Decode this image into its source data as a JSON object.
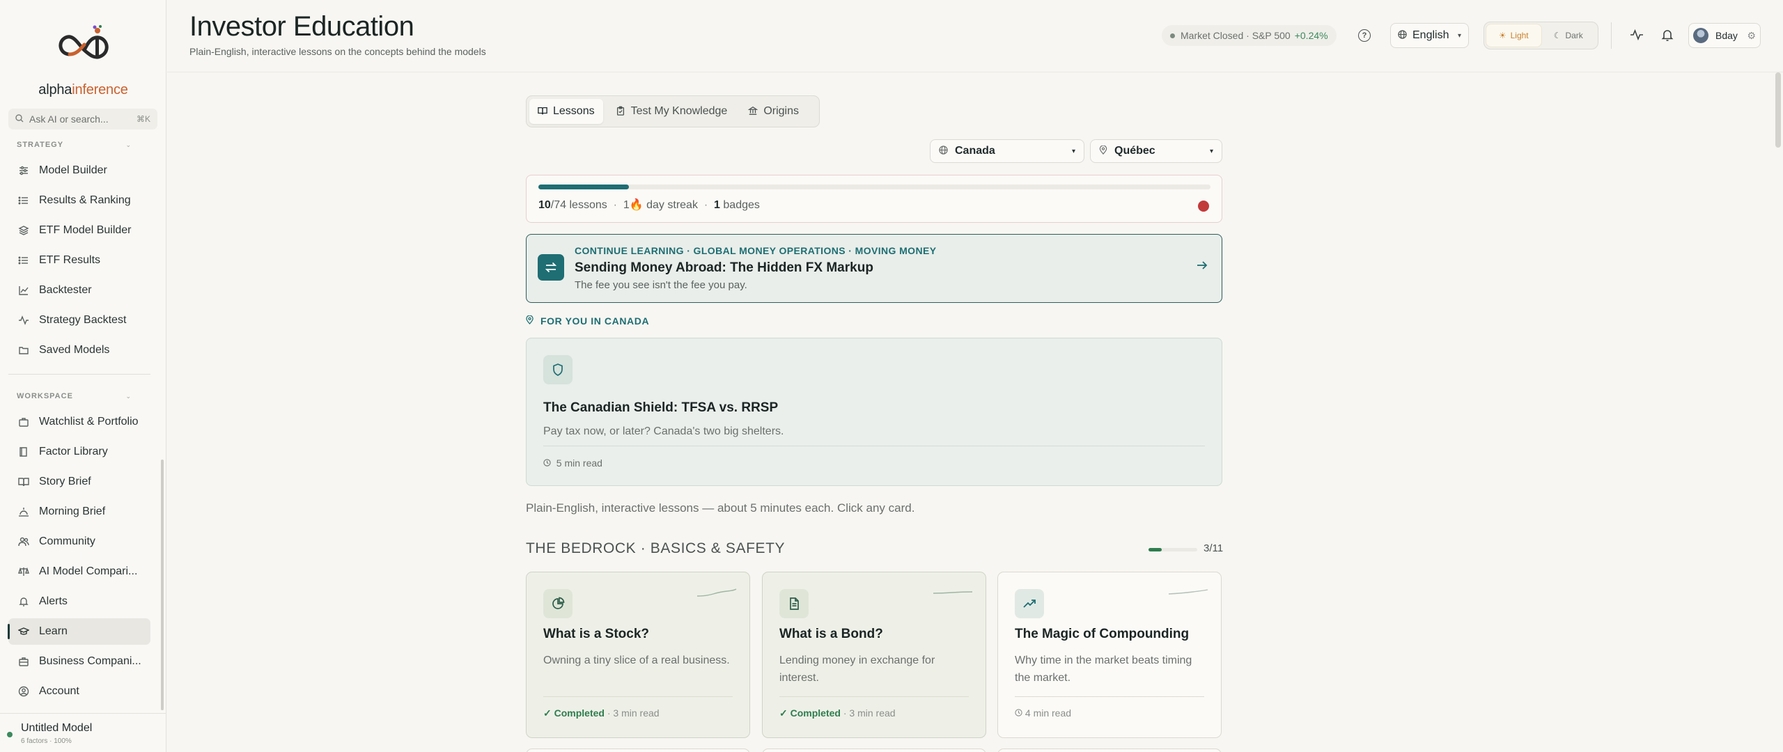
{
  "sidebar": {
    "brand_prefix": "alpha",
    "brand_suffix": "inference",
    "search_placeholder": "Ask AI or search...",
    "search_shortcut": "⌘K",
    "strategy_label": "STRATEGY",
    "strategy_items": [
      {
        "label": "Model Builder",
        "icon": "sliders-icon"
      },
      {
        "label": "Results & Ranking",
        "icon": "list-icon"
      },
      {
        "label": "ETF Model Builder",
        "icon": "layers-icon"
      },
      {
        "label": "ETF Results",
        "icon": "list-icon"
      },
      {
        "label": "Backtester",
        "icon": "chart-line-icon"
      },
      {
        "label": "Strategy Backtest",
        "icon": "activity-icon"
      },
      {
        "label": "Saved Models",
        "icon": "folder-icon"
      }
    ],
    "workspace_label": "WORKSPACE",
    "workspace_items": [
      {
        "label": "Watchlist & Portfolio",
        "icon": "briefcase-icon"
      },
      {
        "label": "Factor Library",
        "icon": "book-icon"
      },
      {
        "label": "Story Brief",
        "icon": "book-open-icon"
      },
      {
        "label": "Morning Brief",
        "icon": "sunrise-icon"
      },
      {
        "label": "Community",
        "icon": "users-icon"
      },
      {
        "label": "AI Model Compari...",
        "icon": "scale-icon"
      },
      {
        "label": "Alerts",
        "icon": "bell-icon"
      },
      {
        "label": "Learn",
        "icon": "graduation-cap-icon",
        "active": true
      },
      {
        "label": "Business Compani...",
        "icon": "building-icon"
      },
      {
        "label": "Account",
        "icon": "user-circle-icon"
      }
    ],
    "model": {
      "name": "Untitled Model",
      "meta": "6 factors · 100%"
    }
  },
  "header": {
    "title": "Investor Education",
    "subtitle": "Plain-English, interactive lessons on the concepts behind the models",
    "market_status": "Market Closed · S&P 500",
    "market_change": "+0.24%",
    "help": "?",
    "language": "English",
    "theme_light": "Light",
    "theme_dark": "Dark",
    "user_name": "Bday"
  },
  "main": {
    "tabs": [
      {
        "label": "Lessons",
        "icon": "book-icon",
        "selected": true
      },
      {
        "label": "Test My Knowledge",
        "icon": "clipboard-icon"
      },
      {
        "label": "Origins",
        "icon": "landmark-icon"
      }
    ],
    "country": "Canada",
    "region": "Québec",
    "progress": {
      "completed": "10",
      "total": "/74 lessons",
      "sep1": "·",
      "streak": "1",
      "streak_emoji": "🔥",
      "streak_label": "day streak",
      "sep2": "·",
      "badges": "1",
      "badges_label": "badges",
      "fraction": 0.135
    },
    "continue": {
      "kicker": "CONTINUE LEARNING · GLOBAL MONEY OPERATIONS · MOVING MONEY",
      "title": "Sending Money Abroad: The Hidden FX Markup",
      "subtitle": "The fee you see isn't the fee you pay."
    },
    "for_you_label": "FOR YOU IN CANADA",
    "featured": {
      "title": "The Canadian Shield: TFSA vs. RRSP",
      "subtitle": "Pay tax now, or later? Canada's two big shelters.",
      "meta": "5 min read"
    },
    "intro": "Plain-English, interactive lessons — about 5 minutes each. Click any card.",
    "section": {
      "title": "THE BEDROCK · BASICS & SAFETY",
      "count": "3/11",
      "fraction": 0.27
    },
    "lessons": [
      {
        "title": "What is a Stock?",
        "subtitle": "Owning a tiny slice of a real business.",
        "status": "Completed",
        "meta": "· 3 min read",
        "icon": "pie-chart-icon"
      },
      {
        "title": "What is a Bond?",
        "subtitle": "Lending money in exchange for interest.",
        "status": "Completed",
        "meta": "· 3 min read",
        "icon": "file-text-icon"
      },
      {
        "title": "The Magic of Compounding",
        "subtitle": "Why time in the market beats timing the market.",
        "status": "",
        "meta": "4 min read",
        "icon": "trending-up-icon"
      }
    ]
  },
  "colors": {
    "accent": "#1e6e73",
    "success": "#2e7d4e",
    "brand_orange": "#c9622f"
  }
}
